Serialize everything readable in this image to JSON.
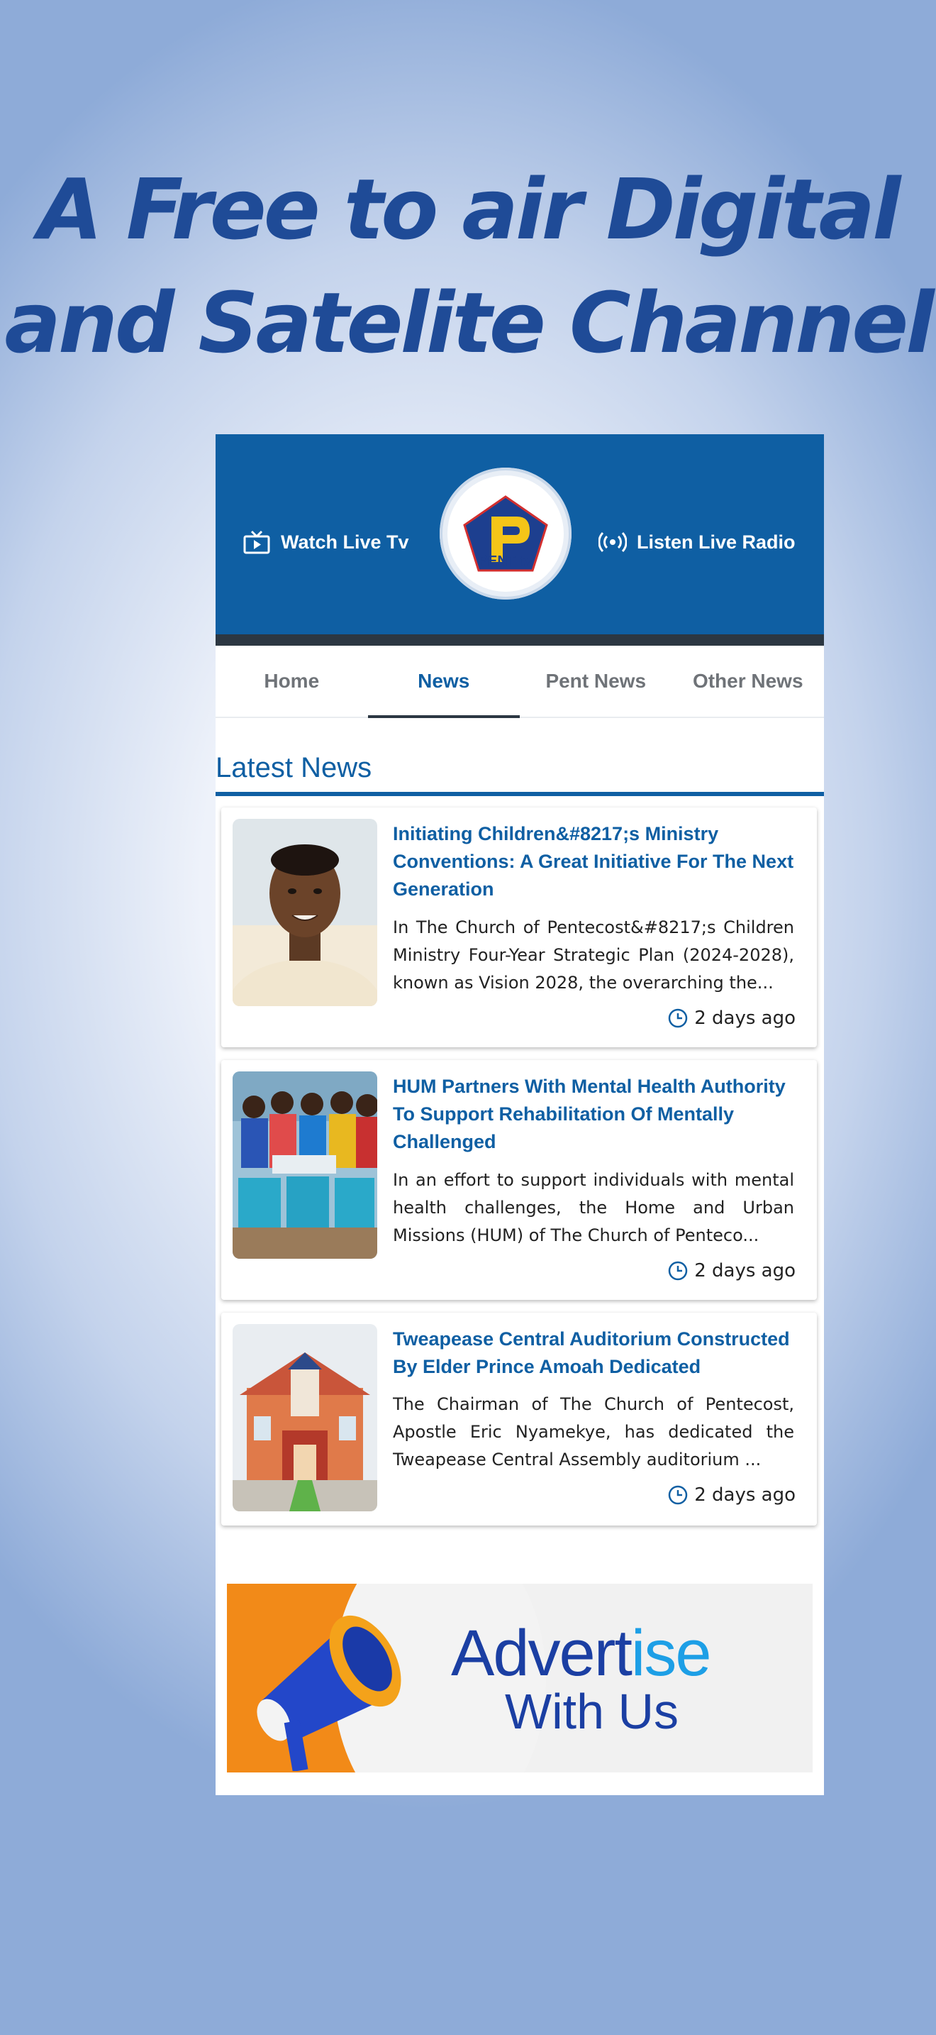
{
  "headline": {
    "line1": "A Free to air Digital",
    "line2": "and Satelite Channel"
  },
  "header": {
    "watch_label": "Watch Live Tv",
    "watch_icon": "tv-play-icon",
    "radio_label": "Listen Live Radio",
    "radio_icon": "broadcast-icon",
    "logo_text": "PENT tv"
  },
  "tabs": [
    {
      "label": "Home",
      "active": false
    },
    {
      "label": "News",
      "active": true
    },
    {
      "label": "Pent News",
      "active": false
    },
    {
      "label": "Other News",
      "active": false
    }
  ],
  "section_title": "Latest News",
  "articles": [
    {
      "title": "Initiating Children&#8217;s Ministry Conventions: A Great Initiative For The Next Generation",
      "excerpt": "In The Church of Pentecost&#8217;s Children Ministry Four-Year Strategic Plan (2024-2028), known as Vision 2028, the overarching the...",
      "time": "2 days ago"
    },
    {
      "title": "HUM Partners With Mental Health Authority To Support Rehabilitation Of Mentally Challenged",
      "excerpt": "In an effort to support individuals with mental health challenges, the Home and Urban Missions (HUM) of The Church of Penteco...",
      "time": "2 days ago"
    },
    {
      "title": "Tweapease Central Auditorium Constructed By Elder Prince Amoah Dedicated",
      "excerpt": "The Chairman of The Church of Pentecost, Apostle Eric Nyamekye, has dedicated the Tweapease Central Assembly auditorium ...",
      "time": "2 days ago"
    }
  ],
  "ad": {
    "word_main": "Advert",
    "word_accent": "ise",
    "sub": "With Us"
  },
  "colors": {
    "brand_blue": "#0f5fa3",
    "headline_blue": "#1f4b97",
    "dark_strip": "#2c3742",
    "ad_orange": "#f28a18"
  }
}
